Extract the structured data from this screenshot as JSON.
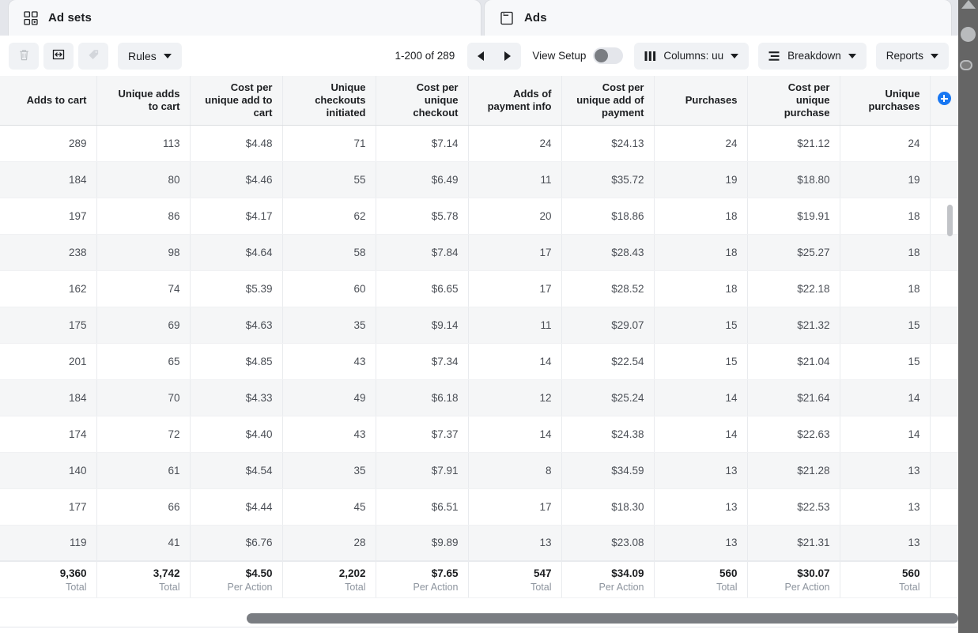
{
  "tabs": [
    {
      "label": "Ad sets",
      "icon": "grid-2x2-icon"
    },
    {
      "label": "Ads",
      "icon": "ad-card-icon"
    }
  ],
  "toolbar": {
    "delete_icon": "trash-icon",
    "duplicate_icon": "duplicate-arrows-icon",
    "tag_icon": "tag-icon",
    "rules_label": "Rules",
    "pagination": "1-200 of 289",
    "prev_icon": "triangle-left-icon",
    "next_icon": "triangle-right-icon",
    "view_setup_label": "View Setup",
    "view_setup_on": false,
    "columns_label": "Columns: uu",
    "columns_icon": "columns-icon",
    "breakdown_label": "Breakdown",
    "breakdown_icon": "breakdown-icon",
    "reports_label": "Reports"
  },
  "table": {
    "add_column_icon": "add-column-plus-icon",
    "columns": [
      "Adds to cart",
      "Unique adds to cart",
      "Cost per unique add to cart",
      "Unique checkouts initiated",
      "Cost per unique checkout",
      "Adds of payment info",
      "Cost per unique add of payment",
      "Purchases",
      "Cost per unique purchase",
      "Unique purchases"
    ],
    "rows": [
      [
        "289",
        "113",
        "$4.48",
        "71",
        "$7.14",
        "24",
        "$24.13",
        "24",
        "$21.12",
        "24"
      ],
      [
        "184",
        "80",
        "$4.46",
        "55",
        "$6.49",
        "11",
        "$35.72",
        "19",
        "$18.80",
        "19"
      ],
      [
        "197",
        "86",
        "$4.17",
        "62",
        "$5.78",
        "20",
        "$18.86",
        "18",
        "$19.91",
        "18"
      ],
      [
        "238",
        "98",
        "$4.64",
        "58",
        "$7.84",
        "17",
        "$28.43",
        "18",
        "$25.27",
        "18"
      ],
      [
        "162",
        "74",
        "$5.39",
        "60",
        "$6.65",
        "17",
        "$28.52",
        "18",
        "$22.18",
        "18"
      ],
      [
        "175",
        "69",
        "$4.63",
        "35",
        "$9.14",
        "11",
        "$29.07",
        "15",
        "$21.32",
        "15"
      ],
      [
        "201",
        "65",
        "$4.85",
        "43",
        "$7.34",
        "14",
        "$22.54",
        "15",
        "$21.04",
        "15"
      ],
      [
        "184",
        "70",
        "$4.33",
        "49",
        "$6.18",
        "12",
        "$25.24",
        "14",
        "$21.64",
        "14"
      ],
      [
        "174",
        "72",
        "$4.40",
        "43",
        "$7.37",
        "14",
        "$24.38",
        "14",
        "$22.63",
        "14"
      ],
      [
        "140",
        "61",
        "$4.54",
        "35",
        "$7.91",
        "8",
        "$34.59",
        "13",
        "$21.28",
        "13"
      ],
      [
        "177",
        "66",
        "$4.44",
        "45",
        "$6.51",
        "17",
        "$18.30",
        "13",
        "$22.53",
        "13"
      ],
      [
        "119",
        "41",
        "$6.76",
        "28",
        "$9.89",
        "13",
        "$23.08",
        "13",
        "$21.31",
        "13"
      ]
    ],
    "totals": [
      {
        "value": "9,360",
        "label": "Total"
      },
      {
        "value": "3,742",
        "label": "Total"
      },
      {
        "value": "$4.50",
        "label": "Per Action"
      },
      {
        "value": "2,202",
        "label": "Total"
      },
      {
        "value": "$7.65",
        "label": "Per Action"
      },
      {
        "value": "547",
        "label": "Total"
      },
      {
        "value": "$34.09",
        "label": "Per Action"
      },
      {
        "value": "560",
        "label": "Total"
      },
      {
        "value": "$30.07",
        "label": "Per Action"
      },
      {
        "value": "560",
        "label": "Total"
      }
    ]
  },
  "colors": {
    "accent": "#1877f2",
    "header_bg": "#f5f6f7",
    "zebra_bg": "#f5f6f7",
    "text": "#1c1e21",
    "muted": "#8d949e",
    "rail": "#656565"
  }
}
